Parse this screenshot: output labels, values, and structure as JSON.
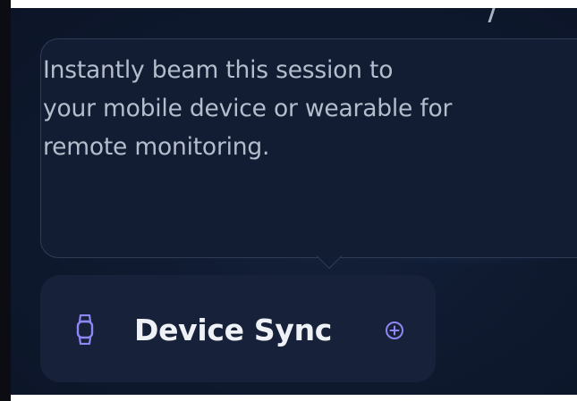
{
  "tooltip": {
    "lines": [
      "Instantly beam this session to",
      "your mobile device or wearable for",
      "remote monitoring."
    ]
  },
  "device_chip": {
    "label": "Device Sync",
    "icon": "watch-icon",
    "action_icon": "plus-circle-icon"
  },
  "colors": {
    "background": "#0f1a30",
    "tooltip_background": "#121d33",
    "chip_background": "#17213a",
    "accent": "#8f86f5",
    "text_primary": "#eef1f6",
    "text_secondary": "#b4bdcc"
  }
}
